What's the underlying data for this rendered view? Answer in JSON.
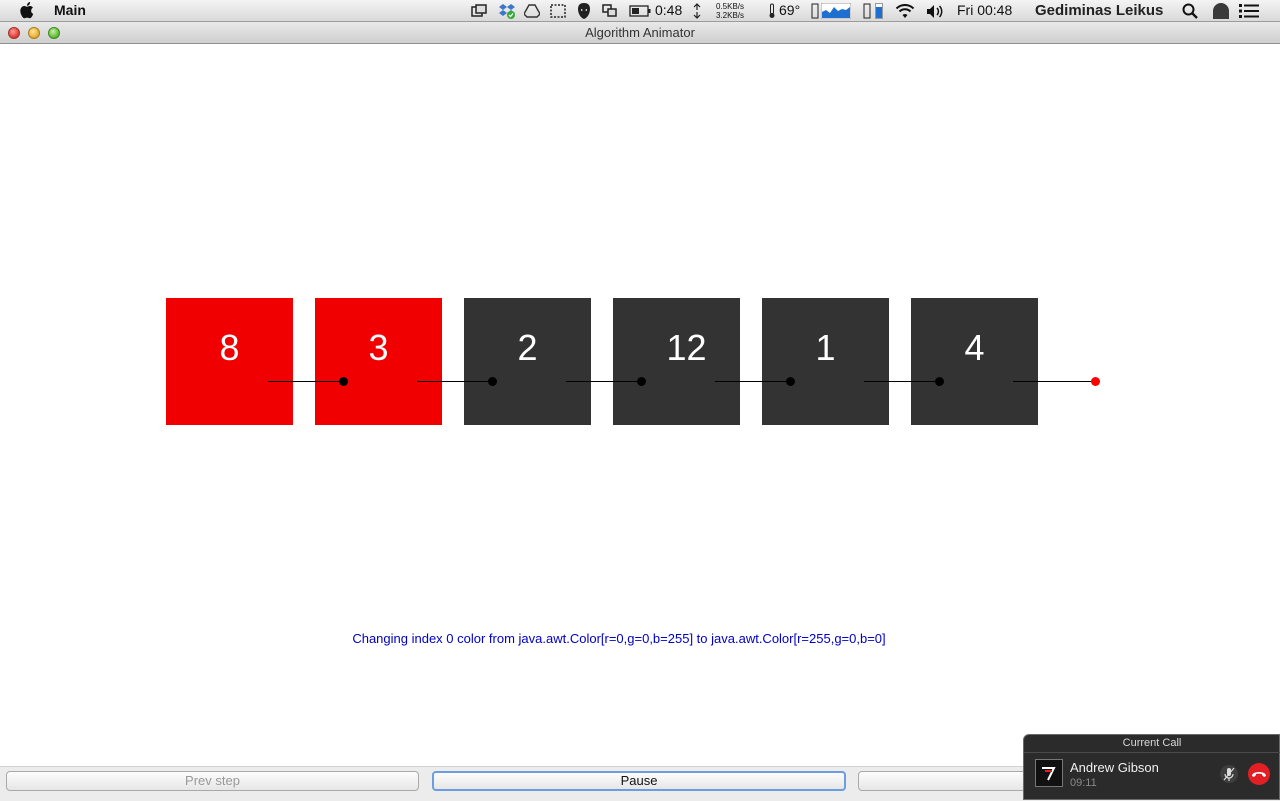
{
  "menubar": {
    "app_name": "Main",
    "battery_time": "0:48",
    "net_up": "0.5KB/s",
    "net_down": "3.2KB/s",
    "temperature": "69°",
    "clock": "Fri 00:48",
    "user_name": "Gediminas Leikus",
    "icons": [
      "apple-icon",
      "window-icon",
      "dropbox-icon",
      "drive-icon",
      "screenshot-icon",
      "mask-icon",
      "sync-icon",
      "battery-icon",
      "cpu-graph-icon",
      "memory-icon",
      "wifi-icon",
      "volume-icon",
      "spotlight-icon",
      "skype-icon",
      "list-icon"
    ]
  },
  "window": {
    "title": "Algorithm Animator"
  },
  "canvas": {
    "nodes": [
      {
        "value": "8",
        "color": "#f00000"
      },
      {
        "value": "3",
        "color": "#f00000"
      },
      {
        "value": "2",
        "color": "#333333"
      },
      {
        "value": "12",
        "color": "#333333"
      },
      {
        "value": "1",
        "color": "#333333"
      },
      {
        "value": "4",
        "color": "#333333"
      }
    ],
    "null_pointer_color": "#ff0000",
    "status_message": "Changing index 0 color from java.awt.Color[r=0,g=0,b=255] to java.awt.Color[r=255,g=0,b=0]",
    "status_color": "#0000c8"
  },
  "controls": {
    "prev_label": "Prev step",
    "pause_label": "Pause",
    "next_label": ""
  },
  "call": {
    "header": "Current Call",
    "caller_name": "Andrew Gibson",
    "duration": "09:11"
  }
}
